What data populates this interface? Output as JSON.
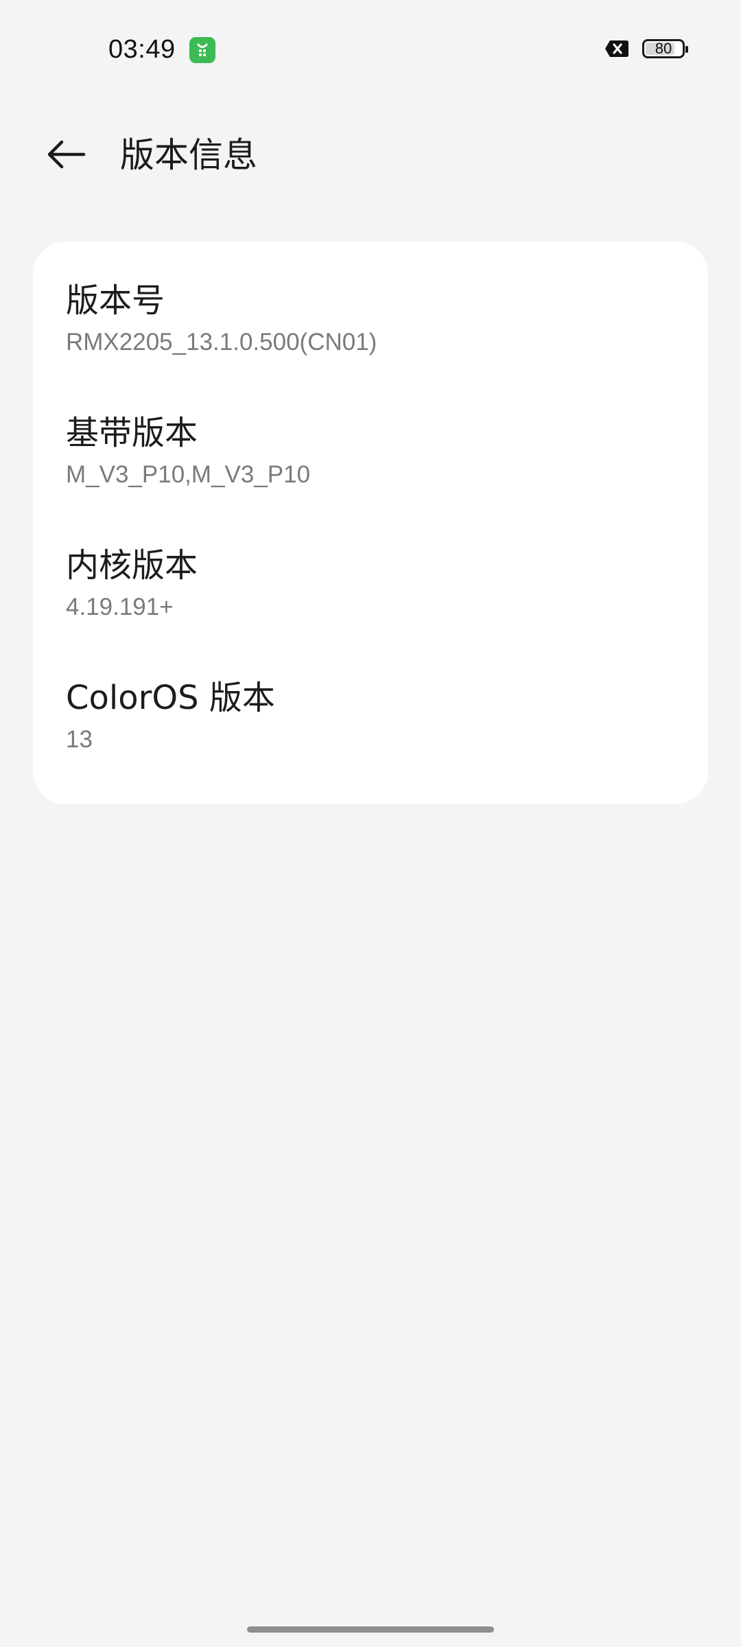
{
  "status_bar": {
    "time": "03:49",
    "app_icon": "shopping-bag-icon",
    "close_icon": "close-box-icon",
    "battery_percent": 80,
    "battery_label": "80"
  },
  "header": {
    "back_icon": "back-arrow-icon",
    "title": "版本信息"
  },
  "info_items": [
    {
      "title": "版本号",
      "value": "RMX2205_13.1.0.500(CN01)"
    },
    {
      "title": "基带版本",
      "value": "M_V3_P10,M_V3_P10"
    },
    {
      "title": "内核版本",
      "value": "4.19.191+"
    },
    {
      "title": "ColorOS 版本",
      "value": "13"
    }
  ],
  "colors": {
    "background": "#f4f4f4",
    "card": "#ffffff",
    "app_icon_green": "#3cba54",
    "secondary_text": "#7a7a7a"
  }
}
